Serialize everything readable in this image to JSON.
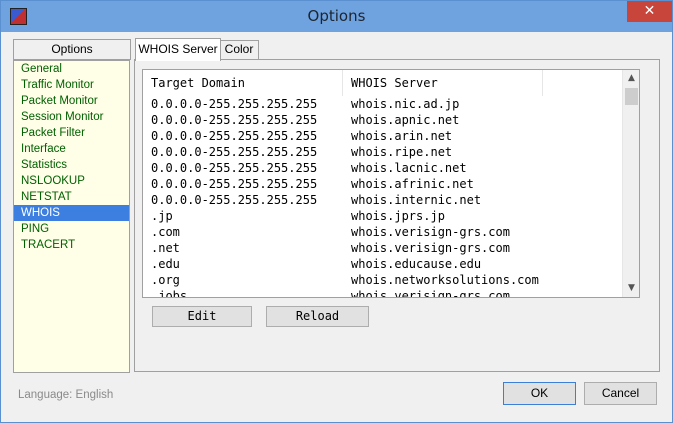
{
  "window": {
    "title": "Options",
    "close_glyph": "✕"
  },
  "sidebar": {
    "header": "Options",
    "items": [
      {
        "label": "General"
      },
      {
        "label": "Traffic Monitor"
      },
      {
        "label": "Packet Monitor"
      },
      {
        "label": "Session Monitor"
      },
      {
        "label": "Packet Filter"
      },
      {
        "label": "Interface"
      },
      {
        "label": "Statistics"
      },
      {
        "label": "NSLOOKUP"
      },
      {
        "label": "NETSTAT"
      },
      {
        "label": "WHOIS",
        "selected": true
      },
      {
        "label": "PING"
      },
      {
        "label": "TRACERT"
      }
    ]
  },
  "tabs": [
    {
      "label": "WHOIS Server",
      "active": true
    },
    {
      "label": "Color",
      "active": false
    }
  ],
  "table": {
    "columns": [
      "Target Domain",
      "WHOIS Server"
    ],
    "rows": [
      [
        "0.0.0.0-255.255.255.255",
        "whois.nic.ad.jp"
      ],
      [
        "0.0.0.0-255.255.255.255",
        "whois.apnic.net"
      ],
      [
        "0.0.0.0-255.255.255.255",
        "whois.arin.net"
      ],
      [
        "0.0.0.0-255.255.255.255",
        "whois.ripe.net"
      ],
      [
        "0.0.0.0-255.255.255.255",
        "whois.lacnic.net"
      ],
      [
        "0.0.0.0-255.255.255.255",
        "whois.afrinic.net"
      ],
      [
        "0.0.0.0-255.255.255.255",
        "whois.internic.net"
      ],
      [
        ".jp",
        "whois.jprs.jp"
      ],
      [
        ".com",
        "whois.verisign-grs.com"
      ],
      [
        ".net",
        "whois.verisign-grs.com"
      ],
      [
        ".edu",
        "whois.educause.edu"
      ],
      [
        ".org",
        "whois.networksolutions.com"
      ],
      [
        ".jobs",
        "whois.verisign-grs.com"
      ]
    ]
  },
  "buttons": {
    "edit": "Edit",
    "reload": "Reload",
    "ok": "OK",
    "cancel": "Cancel"
  },
  "footer": {
    "language": "Language: English"
  },
  "colors": {
    "titlebar": "#6fa3e0",
    "selection": "#3d7fe0",
    "sidebar_bg": "#ffffe8",
    "sidebar_text": "#006000",
    "close": "#c7453a"
  }
}
